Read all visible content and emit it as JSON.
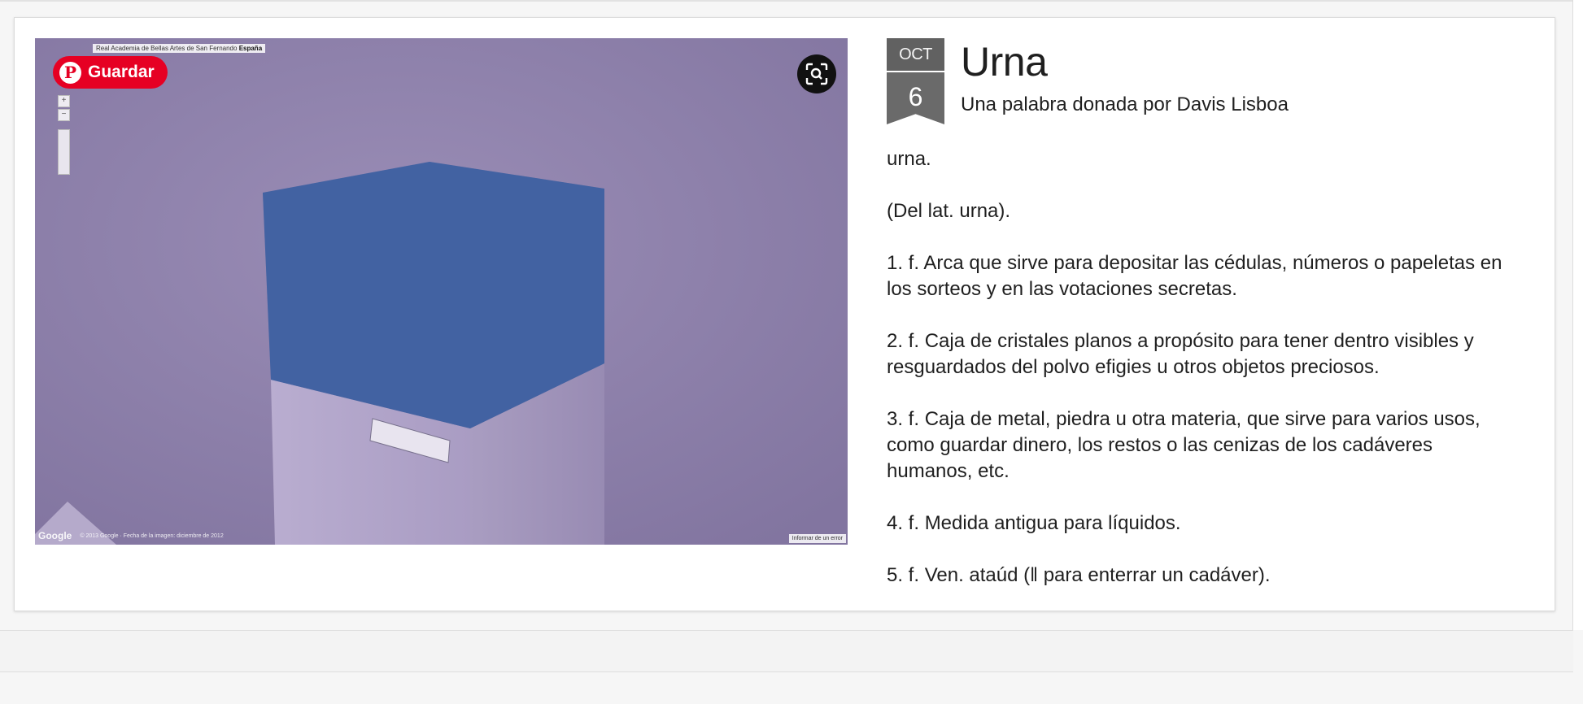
{
  "post": {
    "date_month": "OCT",
    "date_day": "6",
    "title": "Urna",
    "subtitle": "Una palabra donada por Davis Lisboa",
    "paragraphs": [
      "urna.",
      "(Del lat. urna).",
      "1. f. Arca que sirve para depositar las cédulas, números o papeletas en los sorteos y en las votaciones secretas.",
      "2. f. Caja de cristales planos a propósito para tener dentro visibles y resguardados del polvo efigies u otros objetos preciosos.",
      "3. f. Caja de metal, piedra u otra materia, que sirve para varios usos, como guardar dinero, los restos o las cenizas de los cadáveres humanos, etc.",
      "4. f. Medida antigua para líquidos.",
      "5. f. Ven. ataúd (‖ para enterrar un cadáver)."
    ]
  },
  "image": {
    "pin_button_label": "Guardar",
    "pin_icon": "pinterest-logo-icon",
    "lens_icon": "visual-search-icon",
    "streetview_label_prefix": "Real Academia de Bellas Artes de San Fernando",
    "streetview_label_country": "España",
    "streetview_google": "Google",
    "streetview_copyright": "© 2013 Google · Fecha de la imagen: diciembre de 2012",
    "streetview_report": "Informar de un error"
  }
}
